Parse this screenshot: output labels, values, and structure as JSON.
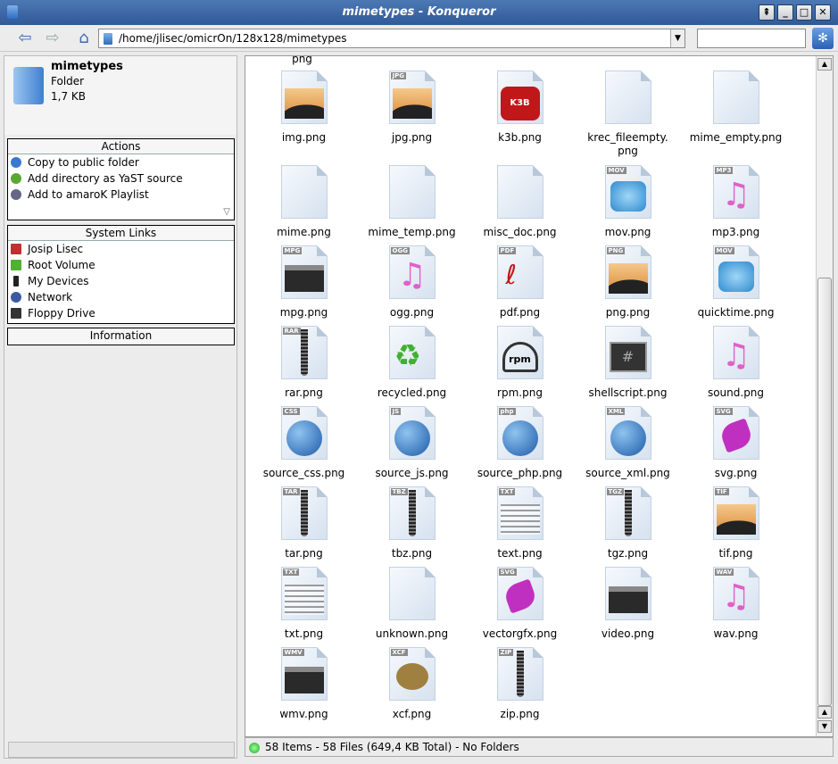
{
  "window": {
    "title": "mimetypes - Konqueror"
  },
  "toolbar": {
    "back_icon": "back-arrow-icon",
    "forward_icon": "forward-arrow-icon",
    "home_icon": "home-icon",
    "location": "/home/jlisec/omicrOn/128x128/mimetypes",
    "search_value": ""
  },
  "info": {
    "name": "mimetypes",
    "type": "Folder",
    "size": "1,7 KB"
  },
  "actions": {
    "header": "Actions",
    "items": [
      {
        "label": "Copy to public folder",
        "icon": "globe-icon",
        "color": "#3a78d0"
      },
      {
        "label": "Add directory as YaST source",
        "icon": "yast-icon",
        "color": "#5aa832"
      },
      {
        "label": "Add to amaroK Playlist",
        "icon": "amarok-icon",
        "color": "#666688"
      }
    ]
  },
  "system_links": {
    "header": "System Links",
    "items": [
      {
        "label": "Josip Lisec",
        "icon": "home-folder-icon",
        "color": "#c03030"
      },
      {
        "label": "Root Volume",
        "icon": "drive-icon",
        "color": "#50b030"
      },
      {
        "label": "My Devices",
        "icon": "devices-icon",
        "color": "#222222"
      },
      {
        "label": "Network",
        "icon": "network-icon",
        "color": "#3a5aa0"
      },
      {
        "label": "Floppy Drive",
        "icon": "floppy-icon",
        "color": "#333333"
      }
    ]
  },
  "information": {
    "header": "Information"
  },
  "partial_label": "png",
  "files": [
    {
      "label": "img.png",
      "badge": "",
      "kind": "image"
    },
    {
      "label": "jpg.png",
      "badge": "JPG",
      "kind": "image"
    },
    {
      "label": "k3b.png",
      "badge": "",
      "kind": "k3b"
    },
    {
      "label": "krec_fileempty.\npng",
      "badge": "",
      "kind": "blank"
    },
    {
      "label": "mime_empty.png",
      "badge": "",
      "kind": "blank"
    },
    {
      "label": "mime.png",
      "badge": "",
      "kind": "blank"
    },
    {
      "label": "mime_temp.png",
      "badge": "",
      "kind": "blank"
    },
    {
      "label": "misc_doc.png",
      "badge": "",
      "kind": "blank"
    },
    {
      "label": "mov.png",
      "badge": "MOV",
      "kind": "quicktime"
    },
    {
      "label": "mp3.png",
      "badge": "MP3",
      "kind": "music"
    },
    {
      "label": "mpg.png",
      "badge": "MPG",
      "kind": "clapper"
    },
    {
      "label": "ogg.png",
      "badge": "OGG",
      "kind": "music"
    },
    {
      "label": "pdf.png",
      "badge": "PDF",
      "kind": "pdf"
    },
    {
      "label": "png.png",
      "badge": "PNG",
      "kind": "image"
    },
    {
      "label": "quicktime.png",
      "badge": "MOV",
      "kind": "quicktime"
    },
    {
      "label": "rar.png",
      "badge": "RAR",
      "kind": "zip"
    },
    {
      "label": "recycled.png",
      "badge": "",
      "kind": "recycle"
    },
    {
      "label": "rpm.png",
      "badge": "",
      "kind": "rpm"
    },
    {
      "label": "shellscript.png",
      "badge": "",
      "kind": "shell"
    },
    {
      "label": "sound.png",
      "badge": "",
      "kind": "music"
    },
    {
      "label": "source_css.png",
      "badge": "CSS",
      "kind": "globe"
    },
    {
      "label": "source_js.png",
      "badge": "JS",
      "kind": "globe"
    },
    {
      "label": "source_php.png",
      "badge": "php",
      "kind": "globe"
    },
    {
      "label": "source_xml.png",
      "badge": "XML",
      "kind": "globe"
    },
    {
      "label": "svg.png",
      "badge": "SVG",
      "kind": "vector"
    },
    {
      "label": "tar.png",
      "badge": "TAR",
      "kind": "zip"
    },
    {
      "label": "tbz.png",
      "badge": "TBZ",
      "kind": "zip"
    },
    {
      "label": "text.png",
      "badge": "TXT",
      "kind": "text"
    },
    {
      "label": "tgz.png",
      "badge": "TGZ",
      "kind": "zip"
    },
    {
      "label": "tif.png",
      "badge": "TIF",
      "kind": "image"
    },
    {
      "label": "txt.png",
      "badge": "TXT",
      "kind": "text"
    },
    {
      "label": "unknown.png",
      "badge": "",
      "kind": "blank"
    },
    {
      "label": "vectorgfx.png",
      "badge": "SVG",
      "kind": "vector"
    },
    {
      "label": "video.png",
      "badge": "",
      "kind": "clapper"
    },
    {
      "label": "wav.png",
      "badge": "WAV",
      "kind": "music"
    },
    {
      "label": "wmv.png",
      "badge": "WMV",
      "kind": "clapper"
    },
    {
      "label": "xcf.png",
      "badge": "XCF",
      "kind": "gimp"
    },
    {
      "label": "zip.png",
      "badge": "ZIP",
      "kind": "zip"
    }
  ],
  "status": {
    "text": "58 Items - 58 Files (649,4 KB Total) - No Folders"
  }
}
